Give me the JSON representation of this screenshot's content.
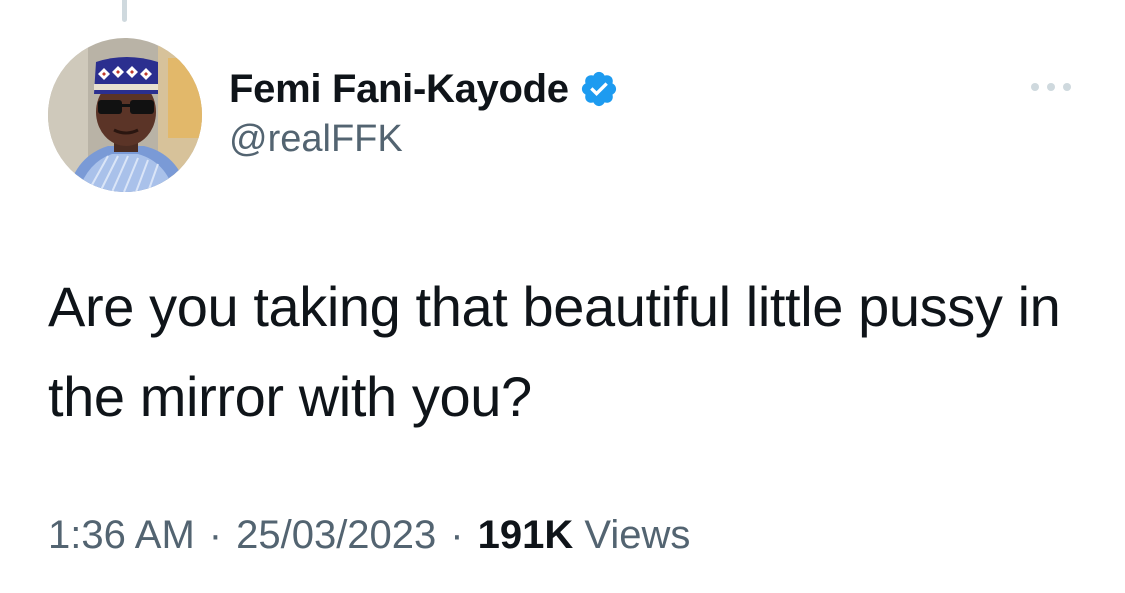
{
  "tweet": {
    "author": {
      "display_name": "Femi Fani-Kayode",
      "handle": "@realFFK",
      "verified": true,
      "avatar_icon": "profile-photo"
    },
    "text": "Are you taking that beautiful little pussy in the mirror with you?",
    "time": "1:36 AM",
    "separator": "·",
    "date": "25/03/2023",
    "views_count": "191K",
    "views_label": "Views"
  },
  "icons": {
    "verified": "verified-badge-icon",
    "more": "more-options-icon"
  },
  "colors": {
    "verified_blue": "#1d9bf0",
    "text_primary": "#0f1419",
    "text_secondary": "#536471",
    "thread_line": "#cfd9de"
  }
}
